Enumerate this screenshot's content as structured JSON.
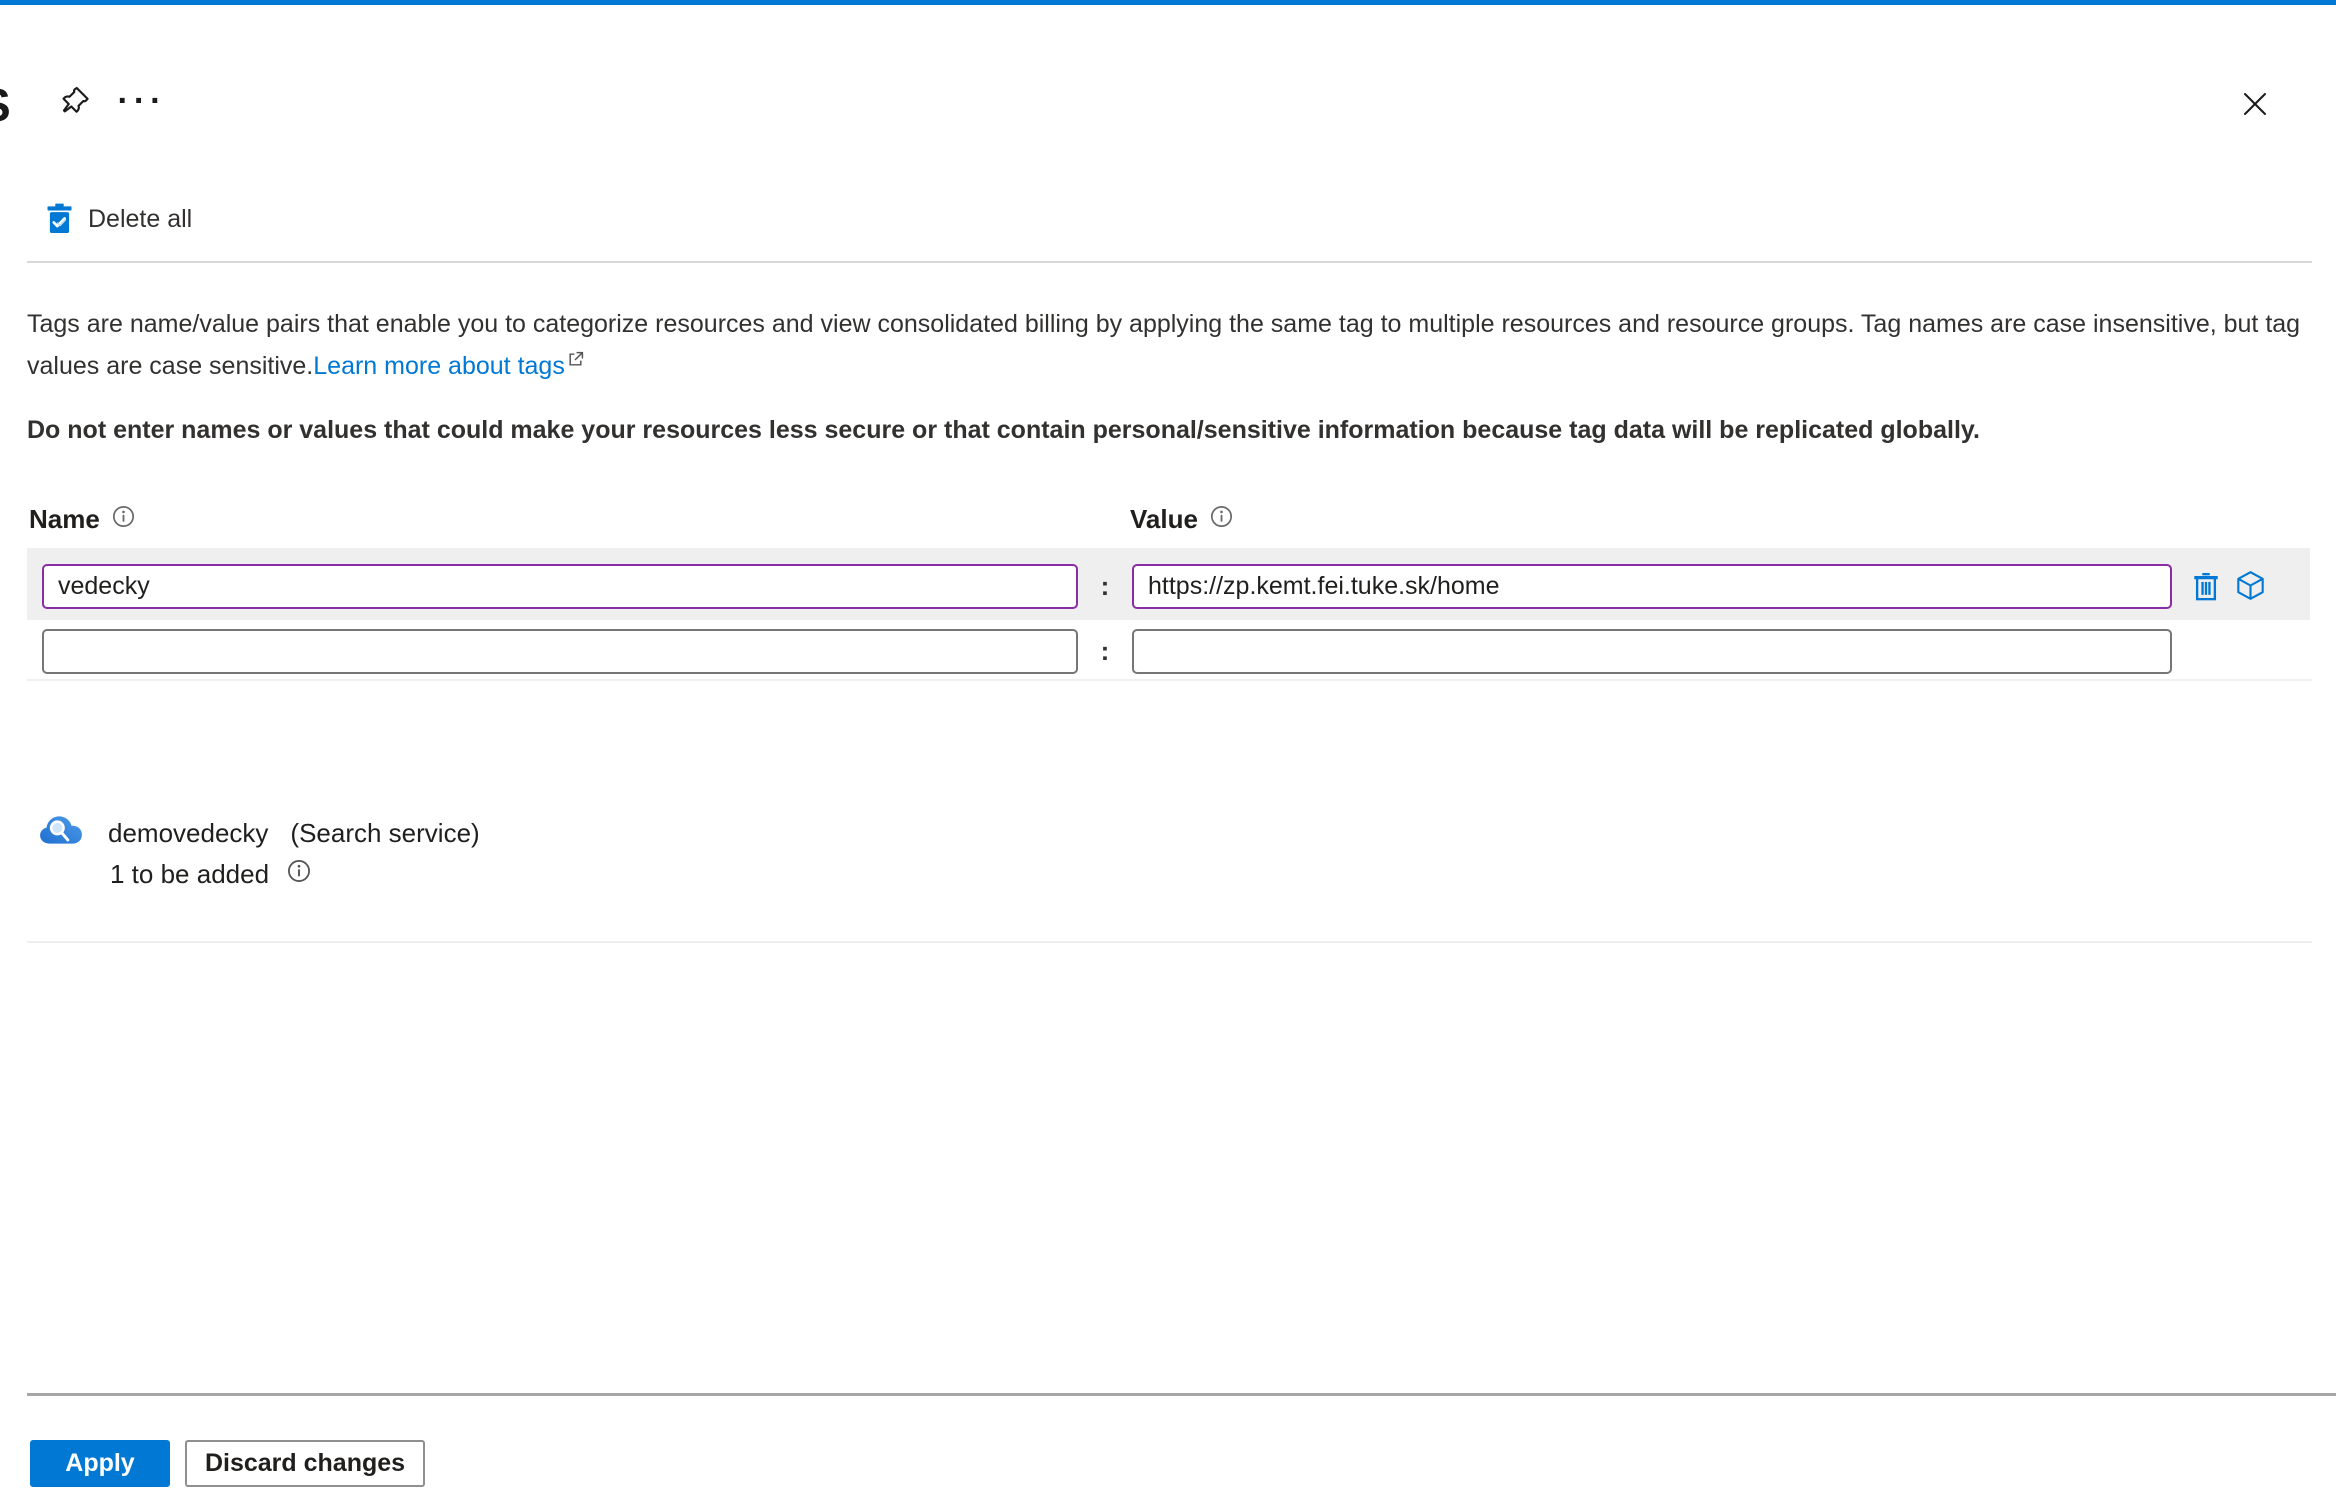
{
  "colors": {
    "accent_blue": "#0078d4",
    "modified_input_border": "#8a2da5",
    "row_highlight": "#efefef",
    "link": "#0078d4"
  },
  "header": {
    "title_fragment": "S",
    "more_glyph": "···"
  },
  "toolbar": {
    "delete_all_label": "Delete all"
  },
  "description": {
    "text": "Tags are name/value pairs that enable you to categorize resources and view consolidated billing by applying the same tag to multiple resources and resource groups. Tag names are case insensitive, but tag values are case sensitive.",
    "link_label": "Learn more about tags"
  },
  "warning": "Do not enter names or values that could make your resources less secure or that contain personal/sensitive information because tag data will be replicated globally.",
  "table": {
    "name_header": "Name",
    "value_header": "Value",
    "separator": ":",
    "rows": [
      {
        "name": "vedecky",
        "value": "https://zp.kemt.fei.tuke.sk/home"
      },
      {
        "name": "",
        "value": ""
      }
    ]
  },
  "resource": {
    "name": "demovedecky",
    "type": "(Search service)",
    "status": "1 to be added"
  },
  "footer": {
    "apply_label": "Apply",
    "discard_label": "Discard changes"
  }
}
